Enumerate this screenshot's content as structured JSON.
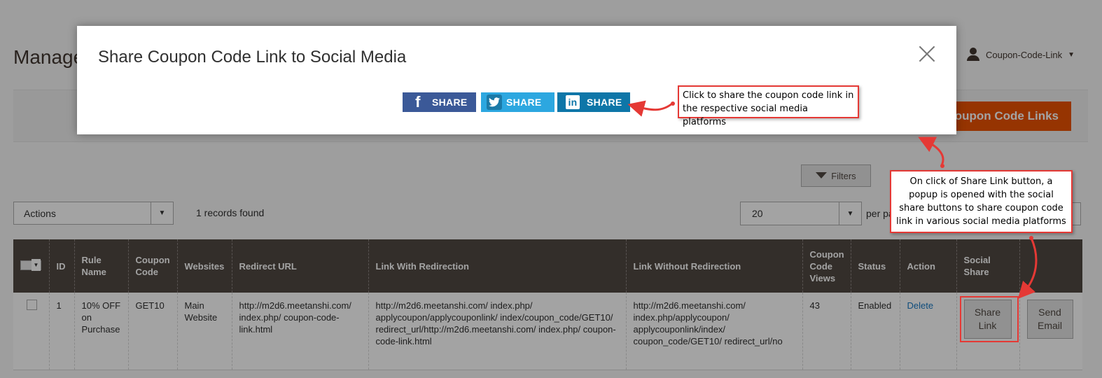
{
  "page": {
    "title": "Manage Coupon Code Links",
    "user_name": "Coupon-Code-Link",
    "primary_button": "Coupon Code Links"
  },
  "toolbar": {
    "filters_label": "Filters",
    "actions_label": "Actions",
    "records_found": "1 records found",
    "per_page_value": "20",
    "per_page_label": "per page"
  },
  "grid": {
    "headers": {
      "id": "ID",
      "rule_name": "Rule Name",
      "coupon_code": "Coupon Code",
      "websites": "Websites",
      "redirect_url": "Redirect URL",
      "link_with": "Link With Redirection",
      "link_without": "Link Without Redirection",
      "views": "Coupon Code Views",
      "status": "Status",
      "action": "Action",
      "social_share": "Social Share"
    },
    "rows": [
      {
        "id": "1",
        "rule_name": "10% OFF on Purchase",
        "coupon_code": "GET10",
        "websites": "Main Website",
        "redirect_url": "http://m2d6.meetanshi.com/ index.php/ coupon-code-link.html",
        "link_with": "http://m2d6.meetanshi.com/ index.php/ applycoupon/applycouponlink/ index/coupon_code/GET10/ redirect_url/http://m2d6.meetanshi.com/ index.php/ coupon-code-link.html",
        "link_without": "http://m2d6.meetanshi.com/ index.php/applycoupon/ applycouponlink/index/ coupon_code/GET10/ redirect_url/no",
        "views": "43",
        "status": "Enabled",
        "action": "Delete",
        "share_link": "Share Link",
        "send_email": "Send Email"
      }
    ]
  },
  "modal": {
    "title": "Share Coupon Code Link to Social Media",
    "share_label": "SHARE",
    "facebook_glyph": "f",
    "linkedin_glyph": "in"
  },
  "callouts": {
    "share_buttons": "Click to share the coupon code link in the respective social media platforms",
    "share_link": "On click of Share Link button, a popup is opened with the social share buttons to share coupon code link in various social media platforms"
  },
  "colors": {
    "brand_orange": "#eb5202",
    "grid_header": "#514943",
    "facebook": "#3b5998",
    "twitter": "#2ca7e0",
    "linkedin": "#0e76a8",
    "annotation_red": "#e53935"
  }
}
